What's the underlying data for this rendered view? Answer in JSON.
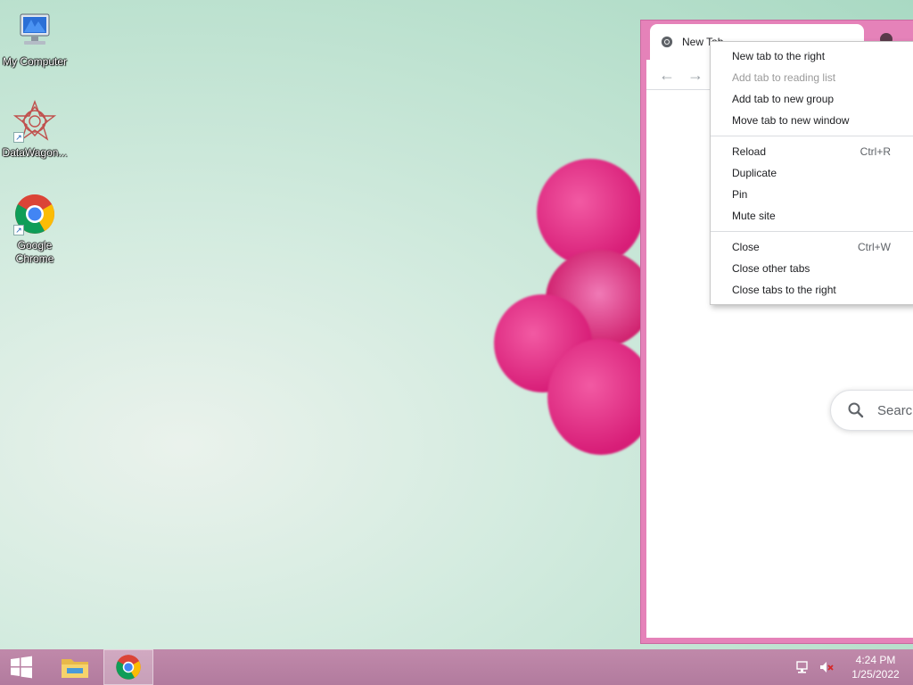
{
  "desktop": {
    "icons": [
      {
        "label": "My Computer"
      },
      {
        "label": "DataWagon..."
      },
      {
        "label": "Google Chrome"
      }
    ]
  },
  "browser": {
    "tab_title": "New Tab",
    "search_placeholder": "Search",
    "frame_color": "#e582b9"
  },
  "context_menu": {
    "groups": [
      [
        {
          "label": "New tab to the right",
          "shortcut": "",
          "disabled": false
        },
        {
          "label": "Add tab to reading list",
          "shortcut": "",
          "disabled": true
        },
        {
          "label": "Add tab to new group",
          "shortcut": "",
          "disabled": false
        },
        {
          "label": "Move tab to new window",
          "shortcut": "",
          "disabled": false
        }
      ],
      [
        {
          "label": "Reload",
          "shortcut": "Ctrl+R",
          "disabled": false
        },
        {
          "label": "Duplicate",
          "shortcut": "",
          "disabled": false
        },
        {
          "label": "Pin",
          "shortcut": "",
          "disabled": false
        },
        {
          "label": "Mute site",
          "shortcut": "",
          "disabled": false
        }
      ],
      [
        {
          "label": "Close",
          "shortcut": "Ctrl+W",
          "disabled": false
        },
        {
          "label": "Close other tabs",
          "shortcut": "",
          "disabled": false
        },
        {
          "label": "Close tabs to the right",
          "shortcut": "",
          "disabled": false
        }
      ]
    ]
  },
  "taskbar": {
    "time": "4:24 PM",
    "date": "1/25/2022",
    "color": "#b27b9e"
  }
}
